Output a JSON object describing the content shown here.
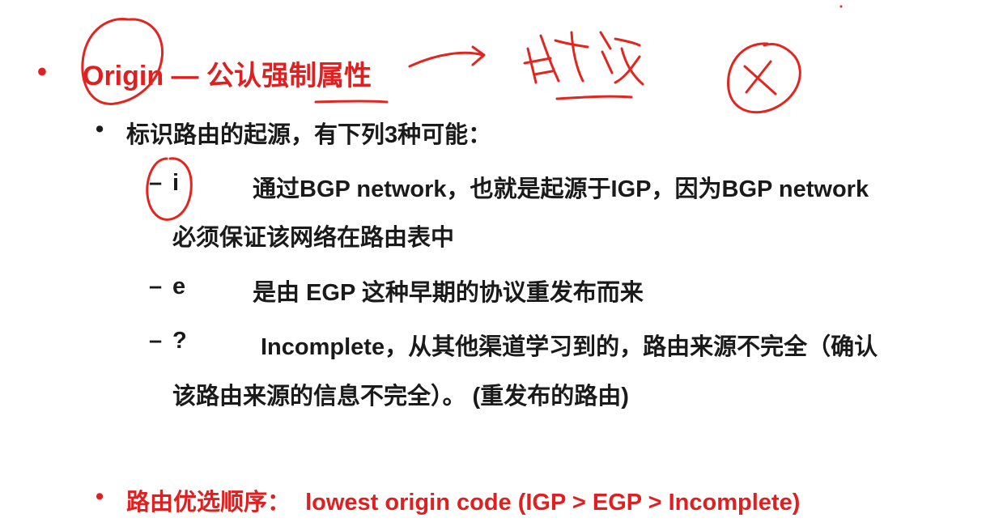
{
  "slide": {
    "heading": {
      "bullet": "•",
      "text": "Origin — 公认强制属性"
    },
    "sub_bullet": {
      "bullet": "•",
      "text": "标识路由的起源，有下列3种可能："
    },
    "items": [
      {
        "dash": "–",
        "code": "i",
        "line1": "通过BGP network，也就是起源于IGP，因为BGP network",
        "line2": "必须保证该网络在路由表中"
      },
      {
        "dash": "–",
        "code": "e",
        "line1": "是由 EGP  这种早期的协议重发布而来",
        "line2": ""
      },
      {
        "dash": "–",
        "code": "?",
        "line1": "Incomplete，从其他渠道学习到的，路由来源不完全（确认",
        "line2": "该路由来源的信息不完全）。 (重发布的路由)"
      }
    ],
    "preference": {
      "bullet": "•",
      "label": "路由优选顺序：",
      "text": "lowest origin code (IGP > EGP > Incomplete)"
    }
  },
  "colors": {
    "accent": "#e02020",
    "text": "#1a1a1a",
    "background": "#ffffff"
  }
}
